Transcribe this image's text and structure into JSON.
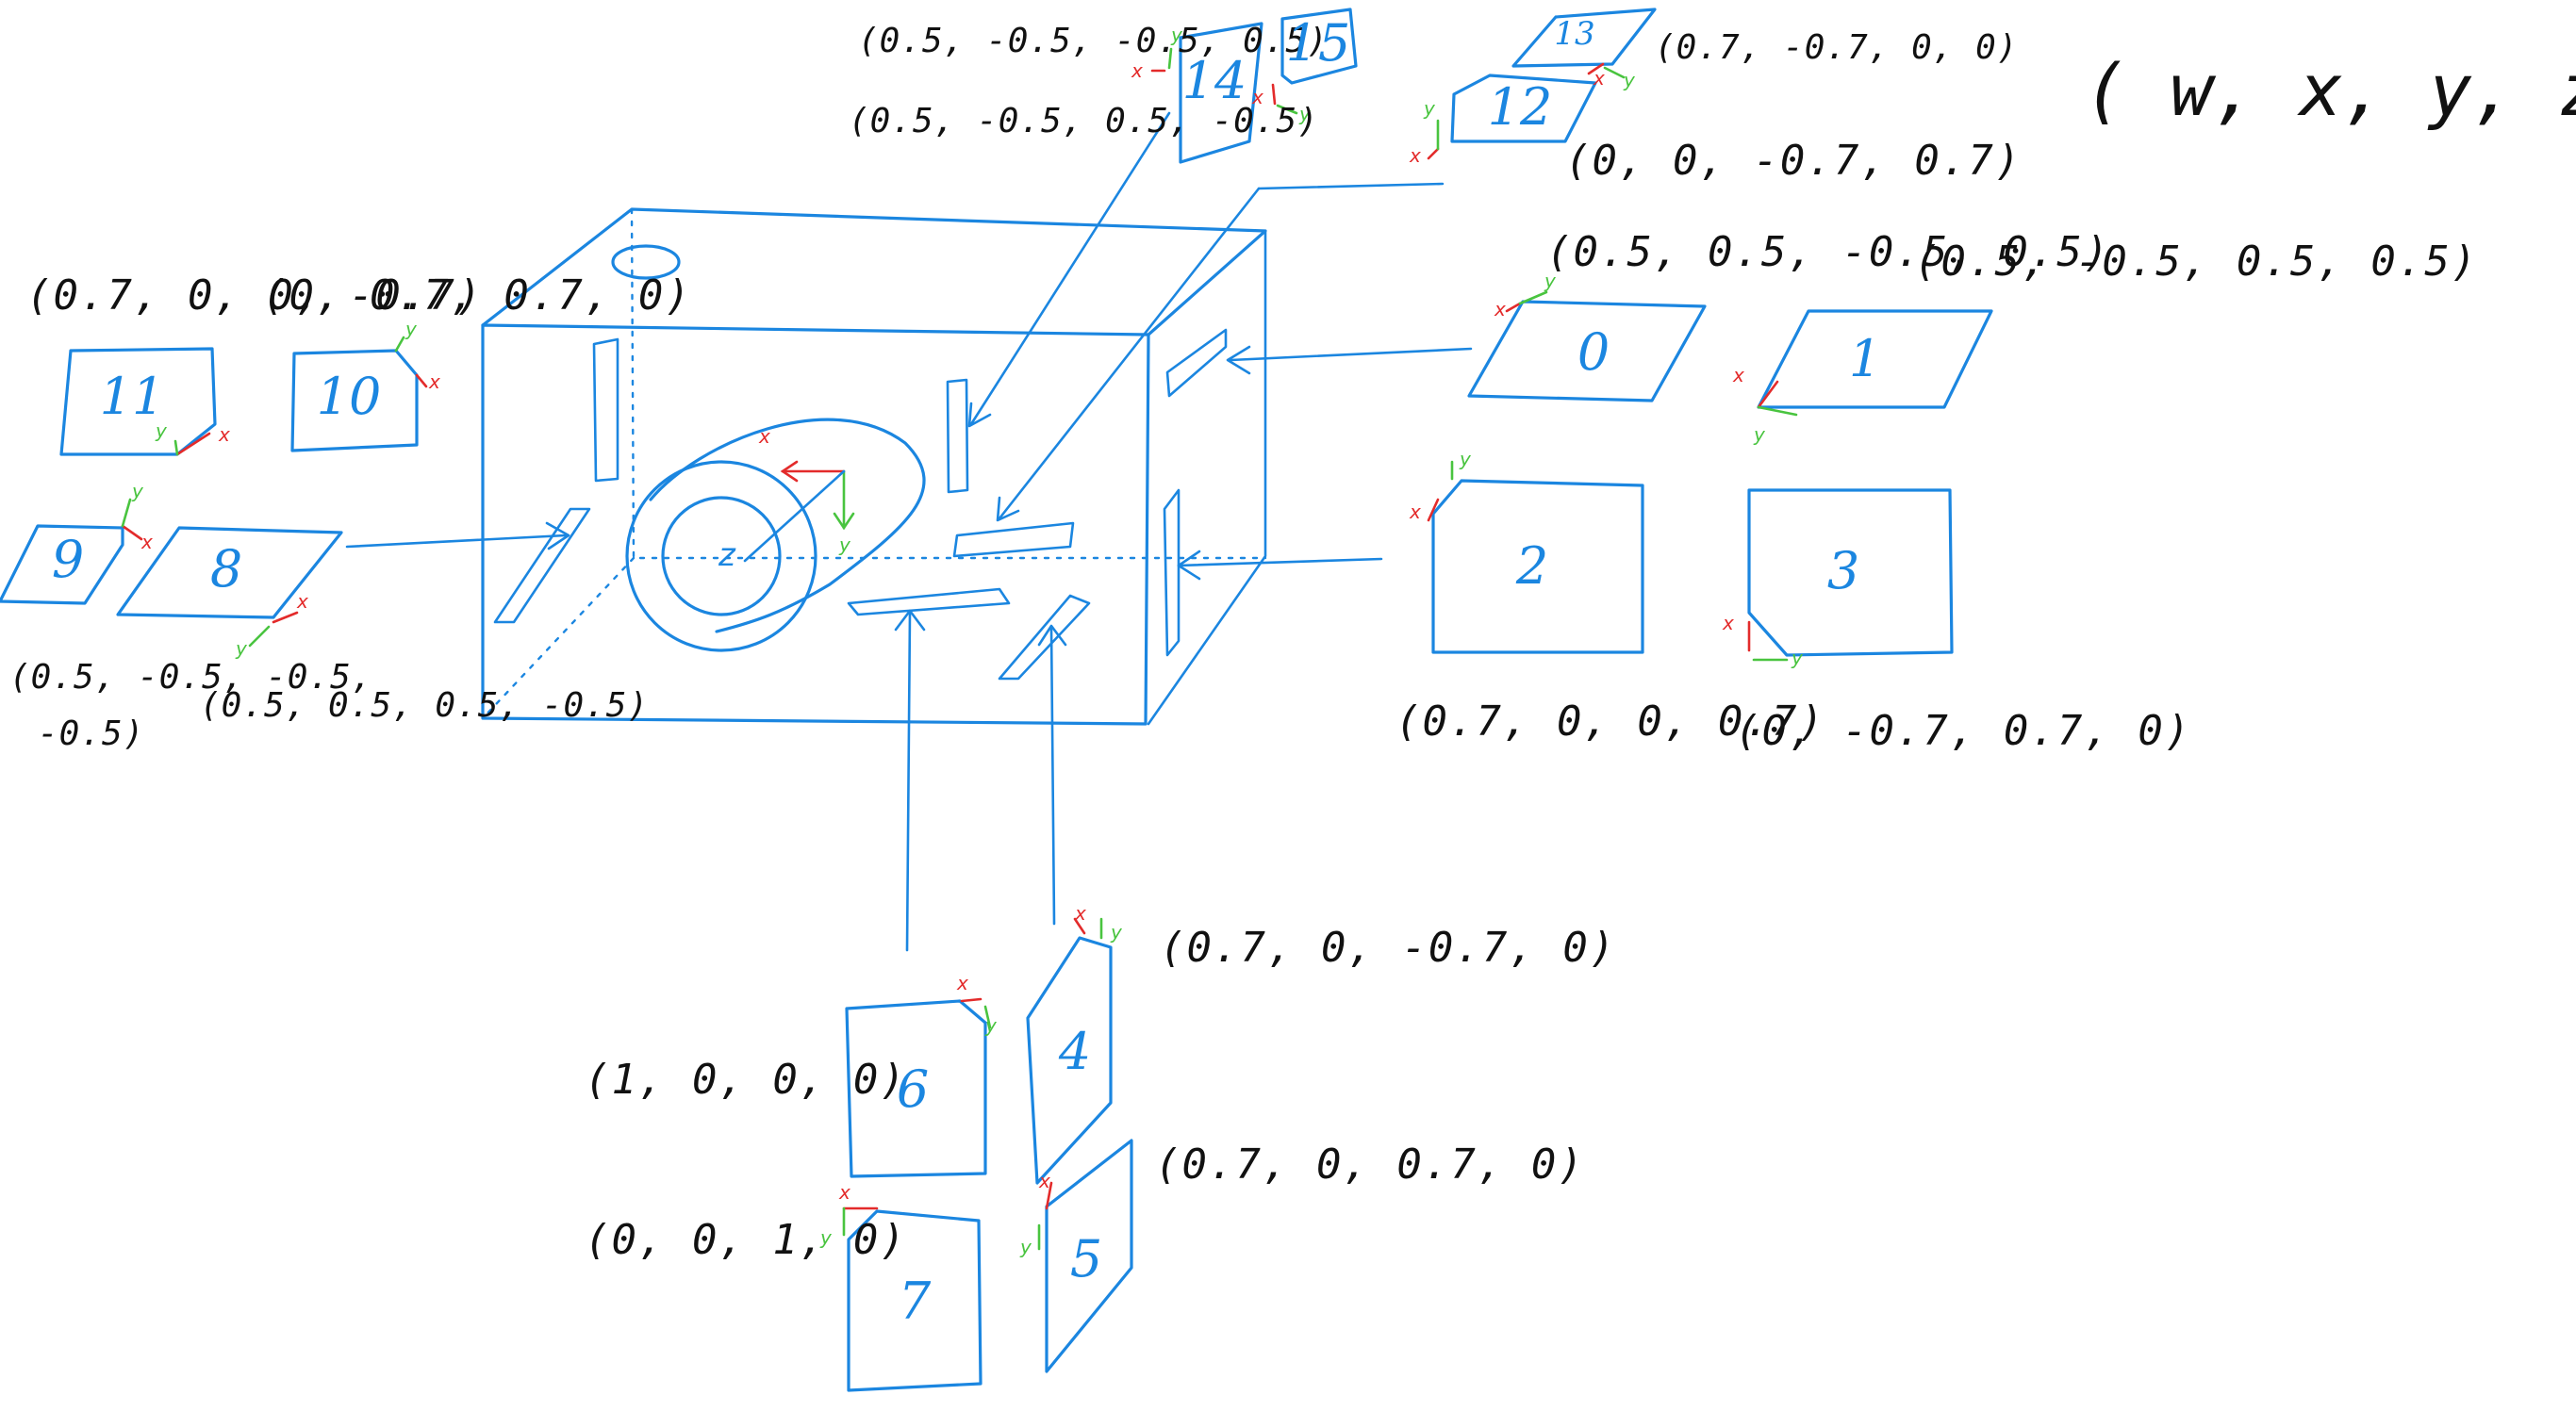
{
  "legend": "( w, x, y, z )",
  "axis_labels": {
    "x": "x",
    "y": "y",
    "z": "z"
  },
  "panels": [
    {
      "id": "0",
      "label": "0",
      "quaternion": "(0.5, 0.5, -0.5, 0.5)"
    },
    {
      "id": "1",
      "label": "1",
      "quaternion": "(0.5, -0.5, 0.5, 0.5)"
    },
    {
      "id": "2",
      "label": "2",
      "quaternion": "(0.7, 0, 0, 0.7)"
    },
    {
      "id": "3",
      "label": "3",
      "quaternion": "(0, -0.7, 0.7, 0)"
    },
    {
      "id": "4",
      "label": "4",
      "quaternion": "(0.7, 0, -0.7, 0)"
    },
    {
      "id": "5",
      "label": "5",
      "quaternion": "(0.7, 0, 0.7, 0)"
    },
    {
      "id": "6",
      "label": "6",
      "quaternion": "(1, 0, 0, 0)"
    },
    {
      "id": "7",
      "label": "7",
      "quaternion": "(0, 0, 1, 0)"
    },
    {
      "id": "8",
      "label": "8",
      "quaternion": "(0.5, 0.5, 0.5, -0.5)"
    },
    {
      "id": "9",
      "label": "9",
      "quaternion_line1": "(0.5, -0.5, -0.5,",
      "quaternion_line2": "-0.5)"
    },
    {
      "id": "10",
      "label": "10",
      "quaternion": "(0, 0.7, 0.7, 0)"
    },
    {
      "id": "11",
      "label": "11",
      "quaternion": "(0.7, 0, 0, -0.7)"
    },
    {
      "id": "12",
      "label": "12",
      "quaternion": "(0, 0, -0.7, 0.7)"
    },
    {
      "id": "13",
      "label": "13",
      "quaternion": "(0.7, -0.7, 0, 0)"
    },
    {
      "id": "14",
      "label": "14",
      "quaternion": "(0.5, -0.5, -0.5, 0.5)"
    },
    {
      "id": "15",
      "label": "15",
      "quaternion": "(0.5, -0.5, 0.5, -0.5)"
    }
  ]
}
